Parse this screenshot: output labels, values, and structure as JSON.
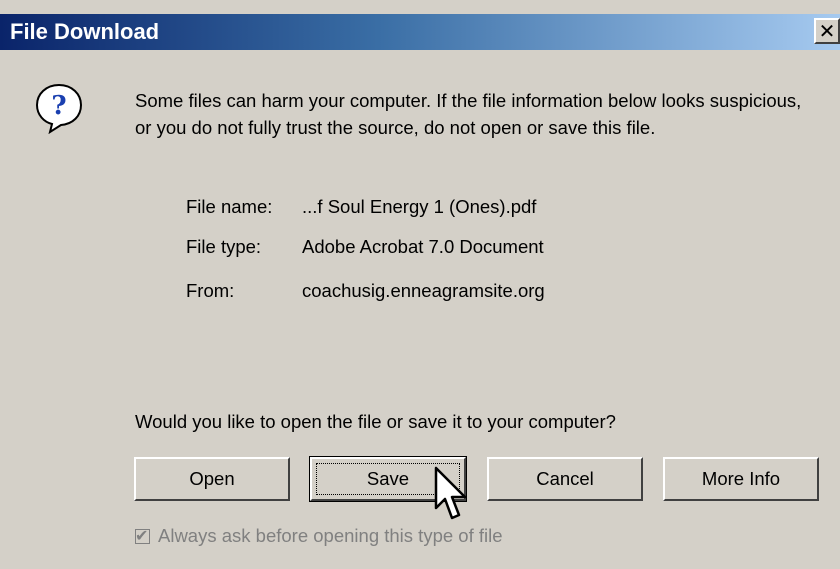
{
  "window": {
    "title": "File Download",
    "close_glyph": "✕"
  },
  "icons": {
    "help": "question-icon",
    "close": "close-icon"
  },
  "message": {
    "warning": "Some files can harm your computer. If the file information below looks suspicious, or you do not fully trust the source, do not open or save this file."
  },
  "file_info": {
    "name_label": "File name:",
    "name_value": "...f Soul Energy 1 (Ones).pdf",
    "type_label": "File type:",
    "type_value": "Adobe Acrobat 7.0 Document",
    "from_label": "From:",
    "from_value": "coachusig.enneagramsite.org"
  },
  "question": "Would you like to open the file or save it to your computer?",
  "buttons": {
    "open": "Open",
    "save": "Save",
    "cancel": "Cancel",
    "more_info": "More Info"
  },
  "checkbox": {
    "label": "Always ask before opening this type of file",
    "checked": true,
    "disabled": true
  },
  "colors": {
    "titlebar_start": "#0a246a",
    "titlebar_end": "#a6caf0",
    "dialog_face": "#d4d0c8",
    "disabled_text": "#808080"
  }
}
